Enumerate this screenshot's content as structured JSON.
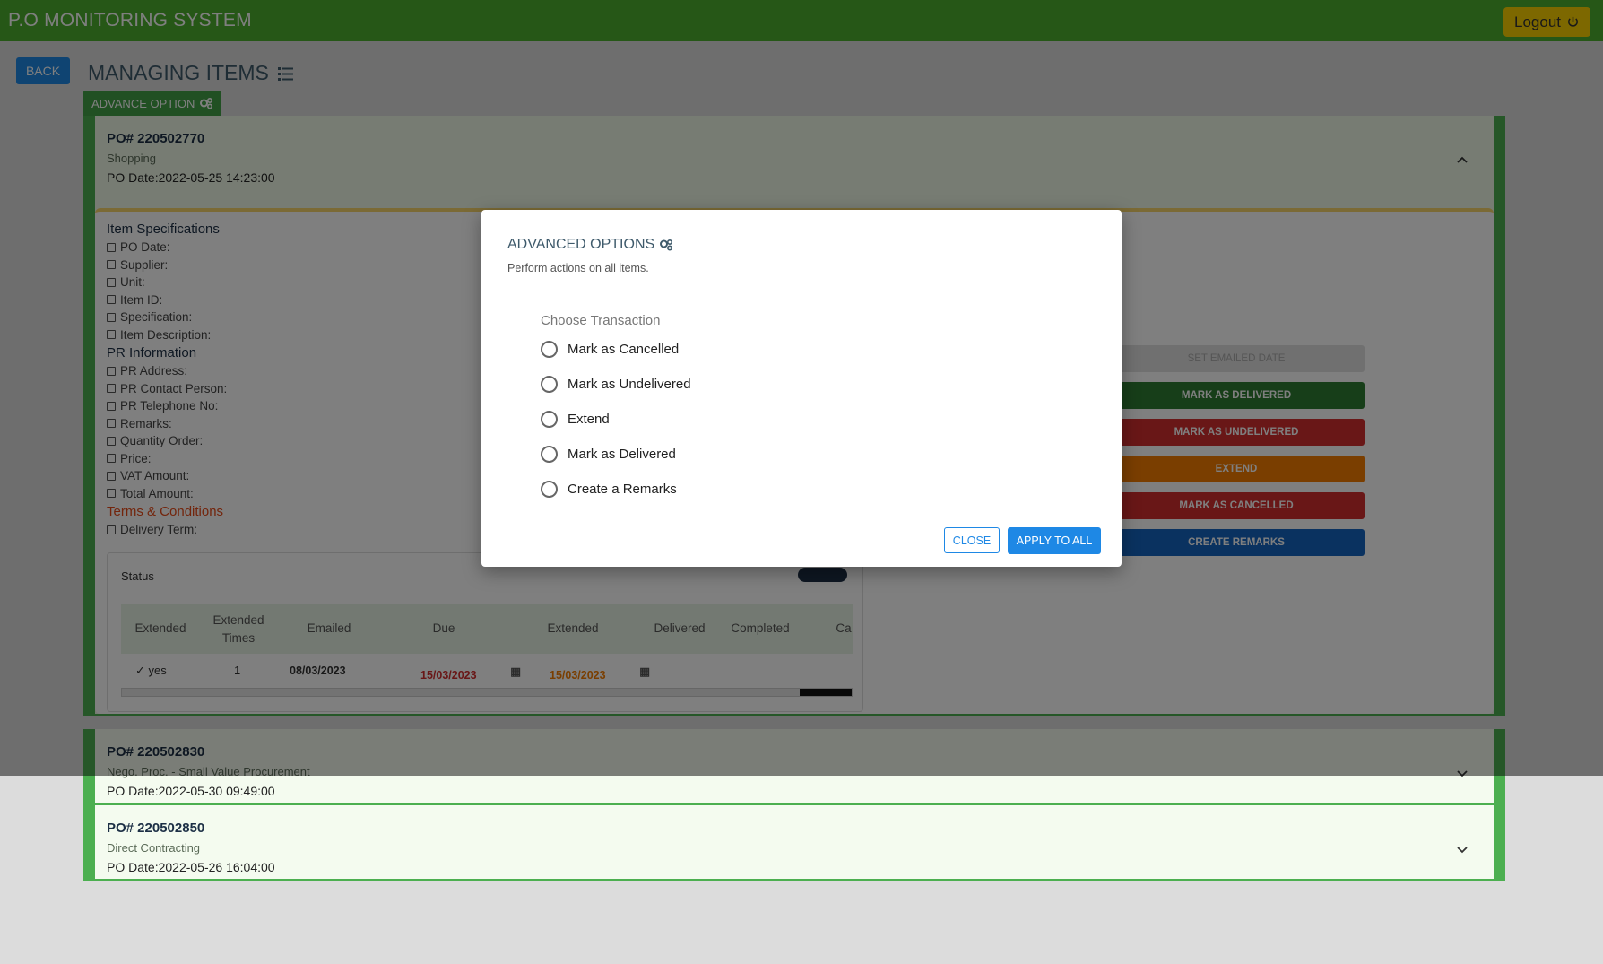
{
  "app": {
    "title": "P.O MONITORING SYSTEM",
    "logout_label": "Logout"
  },
  "page": {
    "back_label": "BACK",
    "title": "MANAGING ITEMS",
    "advance_option_label": "ADVANCE OPTION"
  },
  "panels": [
    {
      "po": "PO# 220502770",
      "type": "Shopping",
      "date": "PO Date:2022-05-25 14:23:00",
      "expanded": true
    },
    {
      "po": "PO# 220502830",
      "type": "Nego. Proc. - Small Value Procurement",
      "date": "PO Date:2022-05-30 09:49:00",
      "expanded": false
    },
    {
      "po": "PO# 220502850",
      "type": "Direct Contracting",
      "date": "PO Date:2022-05-26 16:04:00",
      "expanded": false
    }
  ],
  "specs": {
    "item_heading": "Item Specifications",
    "item_fields": [
      "PO Date:",
      "Supplier:",
      "Unit:",
      "Item ID:",
      "Specification:",
      "Item Description:"
    ],
    "pr_heading": "PR Information",
    "pr_fields": [
      "PR Address:",
      "PR Contact Person:",
      "PR Telephone No:",
      "Remarks:",
      "Quantity Order:",
      "Price:",
      "VAT Amount:",
      "Total Amount:"
    ],
    "terms_heading": "Terms & Conditions",
    "terms_fields": [
      "Delivery Term:"
    ]
  },
  "status": {
    "label": "Status",
    "columns": [
      "Extended",
      "Extended Times",
      "Emailed",
      "Due",
      "Extended",
      "Delivered",
      "Completed",
      "Ca"
    ],
    "row": {
      "extended": "yes",
      "times": "1",
      "emailed": "08/03/2023",
      "due": "15/03/2023",
      "extended_date": "15/03/2023"
    }
  },
  "actions": {
    "emailed": "SET EMAILED DATE",
    "delivered": "MARK AS DELIVERED",
    "undelivered": "MARK AS UNDELIVERED",
    "extend": "EXTEND",
    "cancelled": "MARK AS CANCELLED",
    "remarks": "CREATE REMARKS"
  },
  "modal": {
    "title": "ADVANCED OPTIONS",
    "subtitle": "Perform actions on all items.",
    "choose_label": "Choose Transaction",
    "options": [
      "Mark as Cancelled",
      "Mark as Undelivered",
      "Extend",
      "Mark as Delivered",
      "Create a Remarks"
    ],
    "close_label": "CLOSE",
    "apply_label": "APPLY TO ALL"
  },
  "colors": {
    "topbar": "#4caf2e",
    "panel_border": "#4caf50",
    "primary": "#1e88e5",
    "logout": "#fbd100"
  }
}
